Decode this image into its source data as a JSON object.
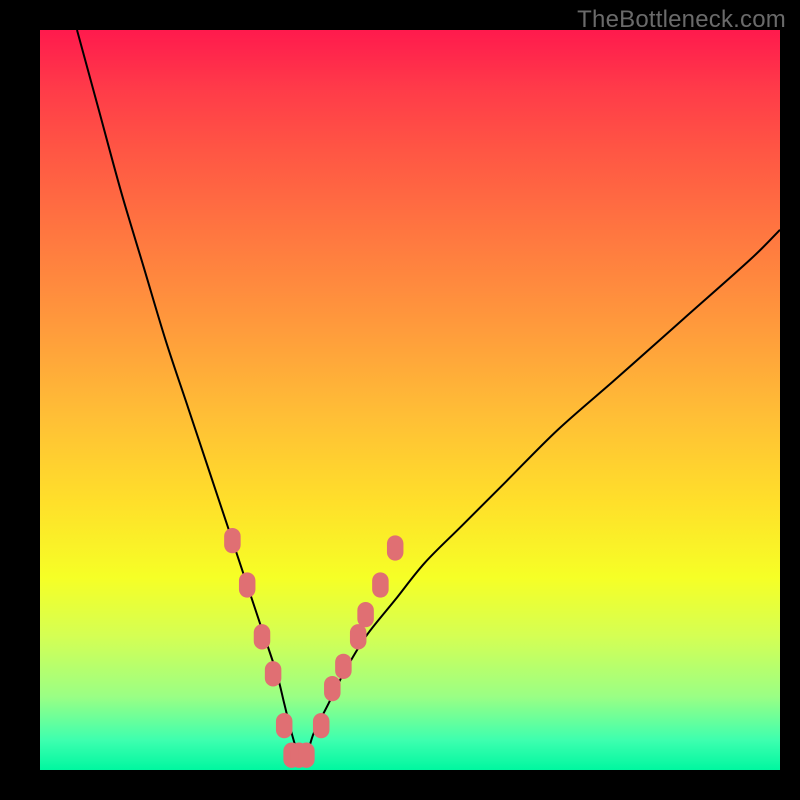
{
  "watermark": "TheBottleneck.com",
  "chart_data": {
    "type": "line",
    "title": "",
    "xlabel": "",
    "ylabel": "",
    "xlim": [
      0,
      100
    ],
    "ylim": [
      0,
      100
    ],
    "grid": false,
    "legend": false,
    "series": [
      {
        "name": "bottleneck-curve",
        "color": "#000000",
        "stroke_width": 2,
        "x": [
          5,
          8,
          11,
          14,
          17,
          20,
          23,
          26,
          28,
          30,
          32,
          33,
          34,
          35,
          36,
          37,
          39,
          41,
          44,
          48,
          52,
          57,
          63,
          70,
          78,
          87,
          96,
          100
        ],
        "values": [
          100,
          89,
          78,
          68,
          58,
          49,
          40,
          31,
          25,
          19,
          13,
          9,
          5,
          2,
          2,
          5,
          9,
          13,
          18,
          23,
          28,
          33,
          39,
          46,
          53,
          61,
          69,
          73
        ]
      }
    ],
    "scatter_overlay": {
      "name": "highlighted-points",
      "color": "#e06f73",
      "marker_size": 11,
      "points": [
        {
          "x": 26,
          "y": 31
        },
        {
          "x": 28,
          "y": 25
        },
        {
          "x": 30,
          "y": 18
        },
        {
          "x": 31.5,
          "y": 13
        },
        {
          "x": 33,
          "y": 6
        },
        {
          "x": 34,
          "y": 2
        },
        {
          "x": 35,
          "y": 2
        },
        {
          "x": 36,
          "y": 2
        },
        {
          "x": 38,
          "y": 6
        },
        {
          "x": 39.5,
          "y": 11
        },
        {
          "x": 41,
          "y": 14
        },
        {
          "x": 43,
          "y": 18
        },
        {
          "x": 44,
          "y": 21
        },
        {
          "x": 46,
          "y": 25
        },
        {
          "x": 48,
          "y": 30
        }
      ]
    },
    "gradient_zones": {
      "comment": "vertical risk gradient — bottom = good (green), top = bad (red)",
      "stops": [
        {
          "pct": 0,
          "color": "#ff1a4d"
        },
        {
          "pct": 50,
          "color": "#ffbe36"
        },
        {
          "pct": 80,
          "color": "#d4ff54"
        },
        {
          "pct": 100,
          "color": "#00f7a0"
        }
      ]
    }
  }
}
